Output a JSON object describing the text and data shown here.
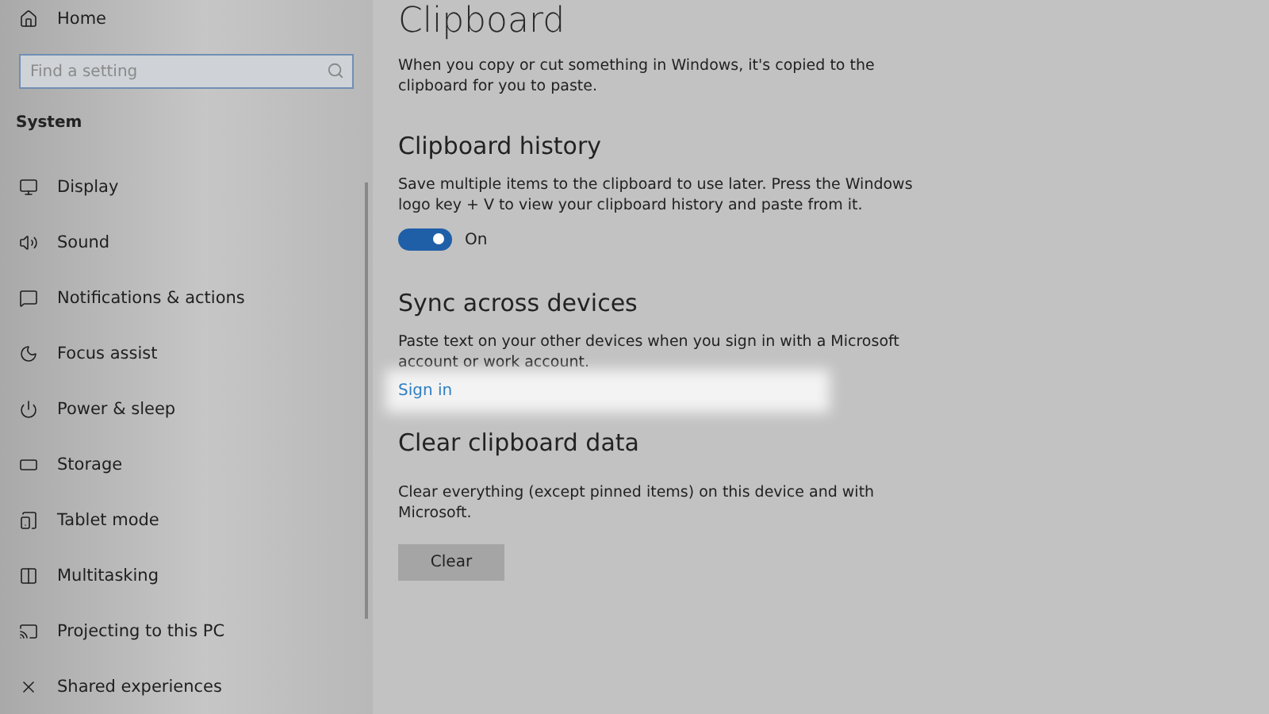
{
  "sidebar": {
    "home": "Home",
    "search": {
      "placeholder": "Find a setting"
    },
    "section": "System",
    "items": [
      {
        "label": "Display",
        "selected": false
      },
      {
        "label": "Sound",
        "selected": false
      },
      {
        "label": "Notifications & actions",
        "selected": false
      },
      {
        "label": "Focus assist",
        "selected": false
      },
      {
        "label": "Power & sleep",
        "selected": false
      },
      {
        "label": "Storage",
        "selected": false
      },
      {
        "label": "Tablet mode",
        "selected": false
      },
      {
        "label": "Multitasking",
        "selected": false
      },
      {
        "label": "Projecting to this PC",
        "selected": false
      },
      {
        "label": "Shared experiences",
        "selected": false
      }
    ]
  },
  "page": {
    "title": "Clipboard",
    "intro": "When you copy or cut something in Windows, it's copied to the clipboard for you to paste.",
    "sections": [
      {
        "kind": "toggle",
        "heading": "Clipboard history",
        "text": "Save multiple items to the clipboard to use later. Press the Windows logo key + V to view your clipboard history and paste from it.",
        "on": true,
        "state_label": "On"
      },
      {
        "kind": "link",
        "heading": "Sync across devices",
        "text": "Paste text on your other devices when you sign in with a Microsoft account or work account.",
        "link": "Sign in"
      },
      {
        "kind": "button",
        "heading": "Clear clipboard data",
        "text": "Clear everything (except pinned items) on this device and with Microsoft.",
        "button": "Clear"
      }
    ]
  }
}
